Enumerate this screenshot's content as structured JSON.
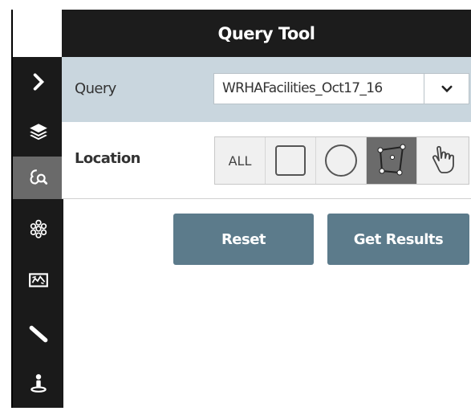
{
  "header": {
    "title": "Query Tool"
  },
  "sidebar": {
    "items": [
      {
        "name": "expand",
        "icon": "chevron-right-icon"
      },
      {
        "name": "layers",
        "icon": "layers-icon"
      },
      {
        "name": "query",
        "icon": "query-icon",
        "active": true
      },
      {
        "name": "cluster",
        "icon": "molecule-icon"
      },
      {
        "name": "basemap",
        "icon": "map-icon"
      },
      {
        "name": "measure",
        "icon": "ruler-icon"
      },
      {
        "name": "legend",
        "icon": "person-icon"
      }
    ]
  },
  "query": {
    "label": "Query",
    "selected": "WRHAFacilities_Oct17_16"
  },
  "location": {
    "label": "Location",
    "tools": [
      {
        "name": "all",
        "label": "ALL"
      },
      {
        "name": "rectangle",
        "icon": "rectangle-icon"
      },
      {
        "name": "circle",
        "icon": "circle-icon"
      },
      {
        "name": "polygon",
        "icon": "polygon-icon",
        "active": true
      },
      {
        "name": "hand",
        "icon": "pointer-hand-icon"
      }
    ]
  },
  "buttons": {
    "reset": "Reset",
    "get_results": "Get Results"
  },
  "colors": {
    "header_bg": "#1c1c1c",
    "query_row_bg": "#c9d6de",
    "button_bg": "#5c7b8b",
    "active_tool_bg": "#6b6b6b"
  }
}
